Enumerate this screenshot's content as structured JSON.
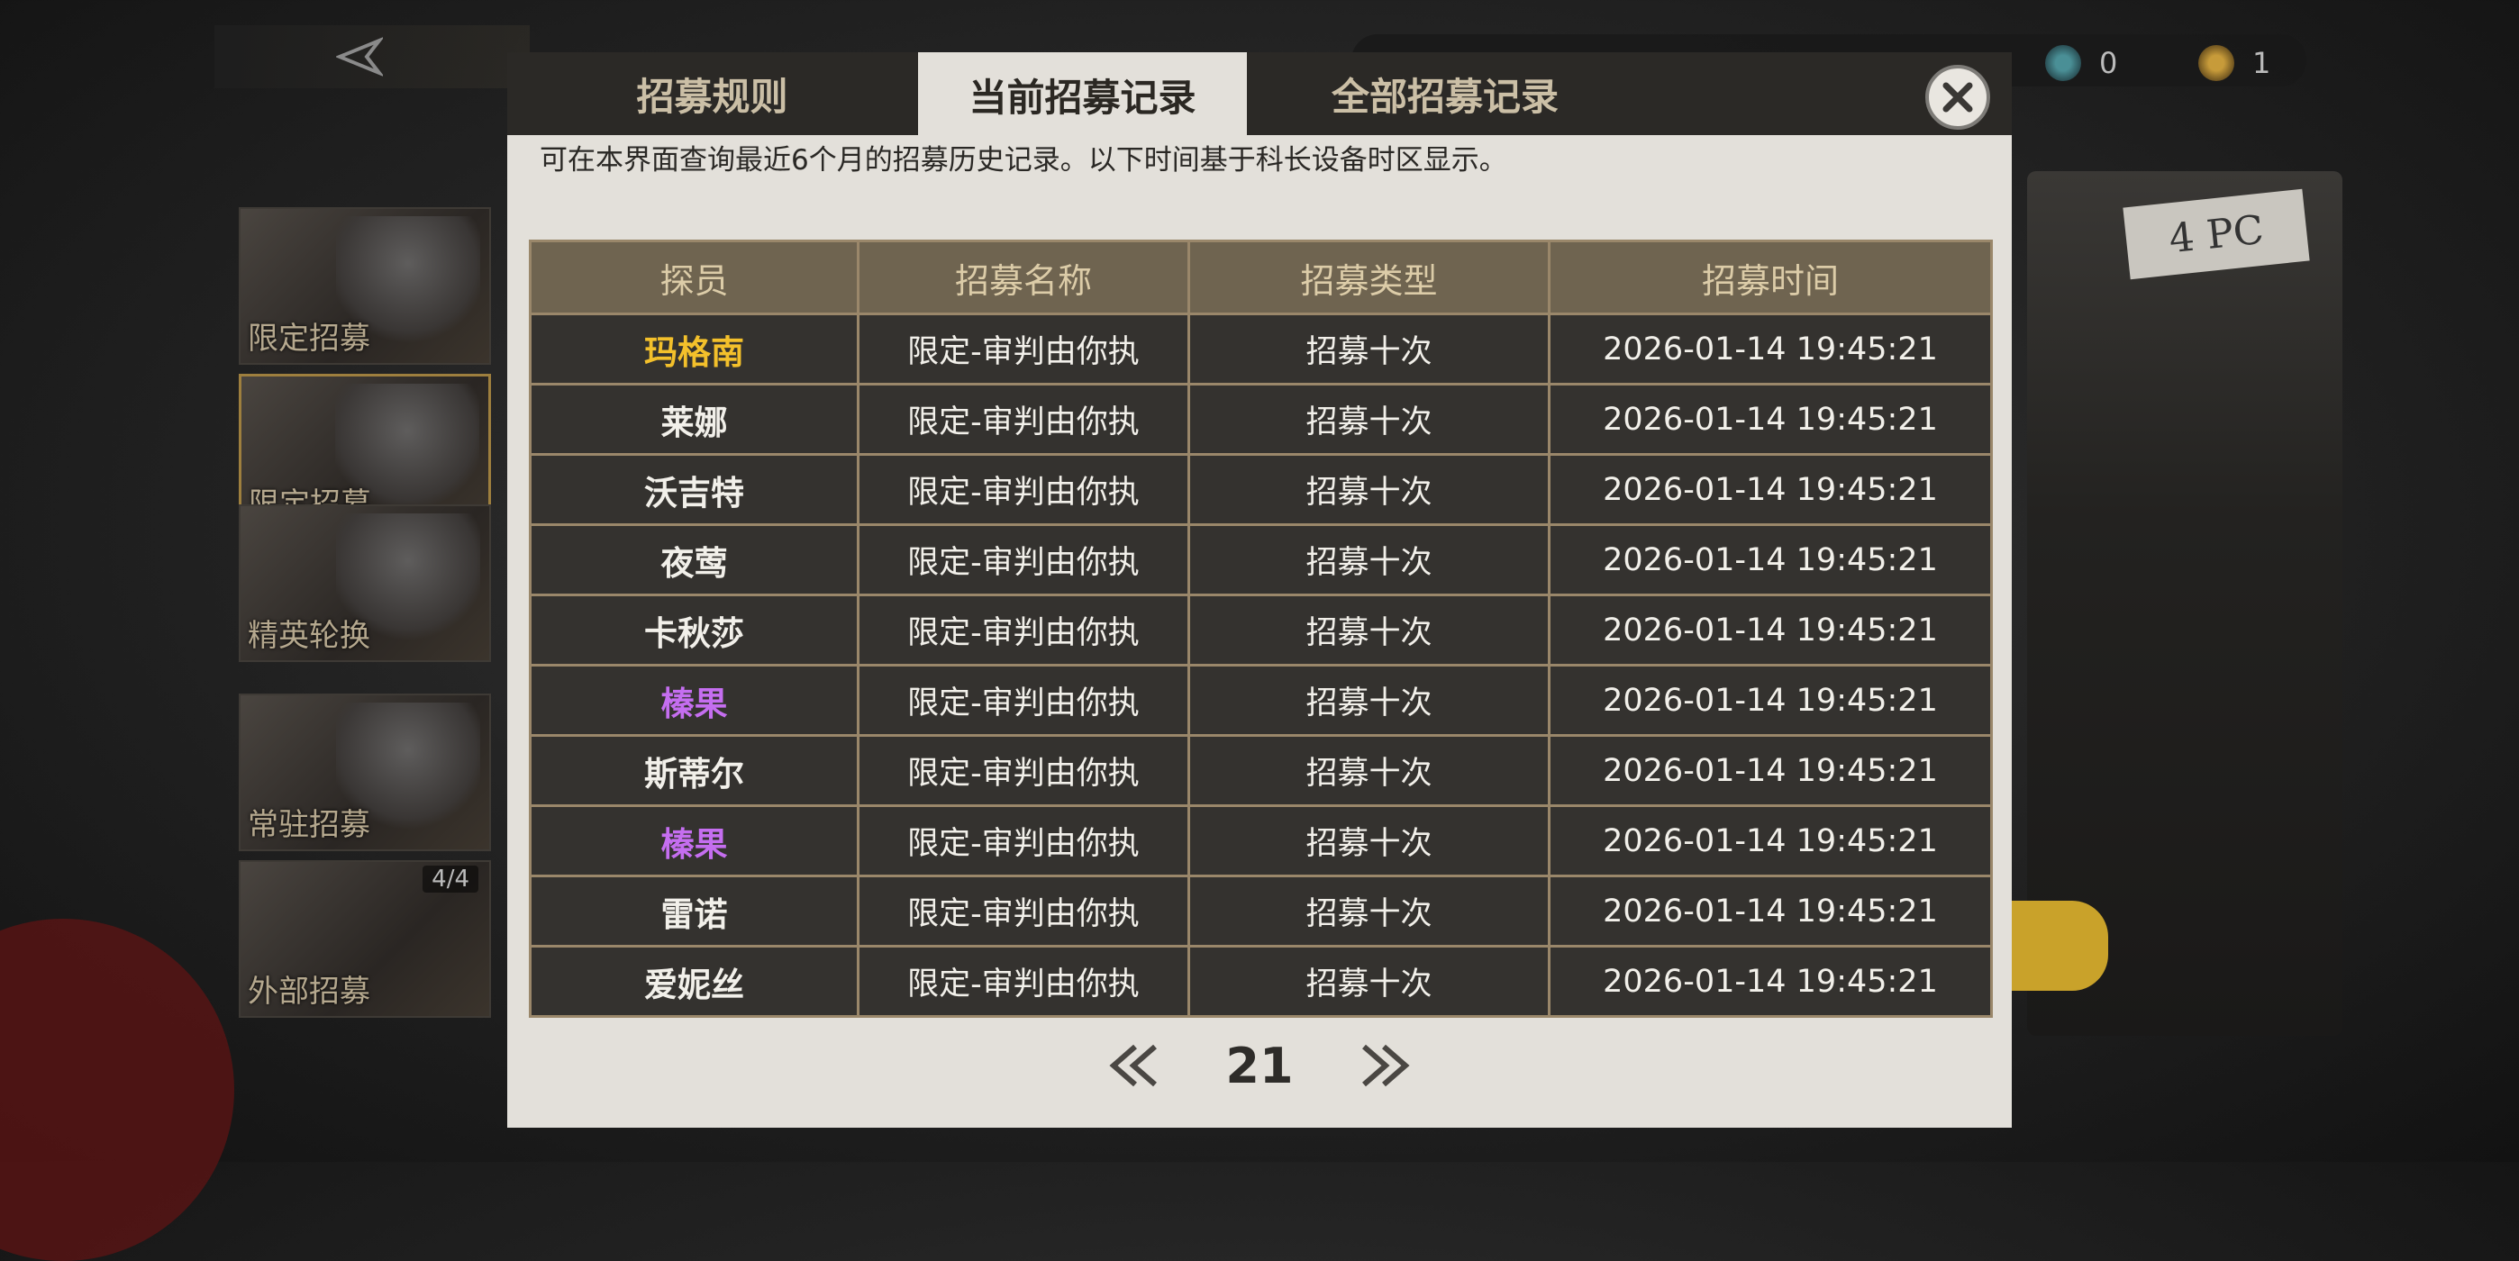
{
  "background": {
    "side_menu": [
      {
        "label": "限定招募",
        "active": false
      },
      {
        "label": "限定招募",
        "active": true
      },
      {
        "label": "精英轮换",
        "active": false
      },
      {
        "label": "常驻招募",
        "active": false
      },
      {
        "label": "外部招募",
        "count": "4/4",
        "active": false
      }
    ],
    "currency": [
      {
        "icon": "blue-coin-icon",
        "value": "0"
      },
      {
        "icon": "gold-coin-icon",
        "value": "1"
      }
    ],
    "tape_label": "4 PC"
  },
  "dialog": {
    "tabs": [
      {
        "label": "招募规则",
        "active": false
      },
      {
        "label": "当前招募记录",
        "active": true
      },
      {
        "label": "全部招募记录",
        "active": false
      }
    ],
    "notice": "可在本界面查询最近6个月的招募历史记录。以下时间基于科长设备时区显示。",
    "table": {
      "headers": [
        "探员",
        "招募名称",
        "招募类型",
        "招募时间"
      ],
      "rows": [
        {
          "name": "玛格南",
          "name_color": "#f3c02b",
          "pool": "限定-审判由你执",
          "type": "招募十次",
          "time": "2026-01-14 19:45:21"
        },
        {
          "name": "莱娜",
          "name_color": "#f2f0ea",
          "pool": "限定-审判由你执",
          "type": "招募十次",
          "time": "2026-01-14 19:45:21"
        },
        {
          "name": "沃吉特",
          "name_color": "#f2f0ea",
          "pool": "限定-审判由你执",
          "type": "招募十次",
          "time": "2026-01-14 19:45:21"
        },
        {
          "name": "夜莺",
          "name_color": "#f2f0ea",
          "pool": "限定-审判由你执",
          "type": "招募十次",
          "time": "2026-01-14 19:45:21"
        },
        {
          "name": "卡秋莎",
          "name_color": "#f2f0ea",
          "pool": "限定-审判由你执",
          "type": "招募十次",
          "time": "2026-01-14 19:45:21"
        },
        {
          "name": "榛果",
          "name_color": "#c56ef0",
          "pool": "限定-审判由你执",
          "type": "招募十次",
          "time": "2026-01-14 19:45:21"
        },
        {
          "name": "斯蒂尔",
          "name_color": "#f2f0ea",
          "pool": "限定-审判由你执",
          "type": "招募十次",
          "time": "2026-01-14 19:45:21"
        },
        {
          "name": "榛果",
          "name_color": "#c56ef0",
          "pool": "限定-审判由你执",
          "type": "招募十次",
          "time": "2026-01-14 19:45:21"
        },
        {
          "name": "雷诺",
          "name_color": "#f2f0ea",
          "pool": "限定-审判由你执",
          "type": "招募十次",
          "time": "2026-01-14 19:45:21"
        },
        {
          "name": "爱妮丝",
          "name_color": "#f2f0ea",
          "pool": "限定-审判由你执",
          "type": "招募十次",
          "time": "2026-01-14 19:45:21"
        }
      ]
    },
    "pagination": {
      "page": "21"
    }
  }
}
